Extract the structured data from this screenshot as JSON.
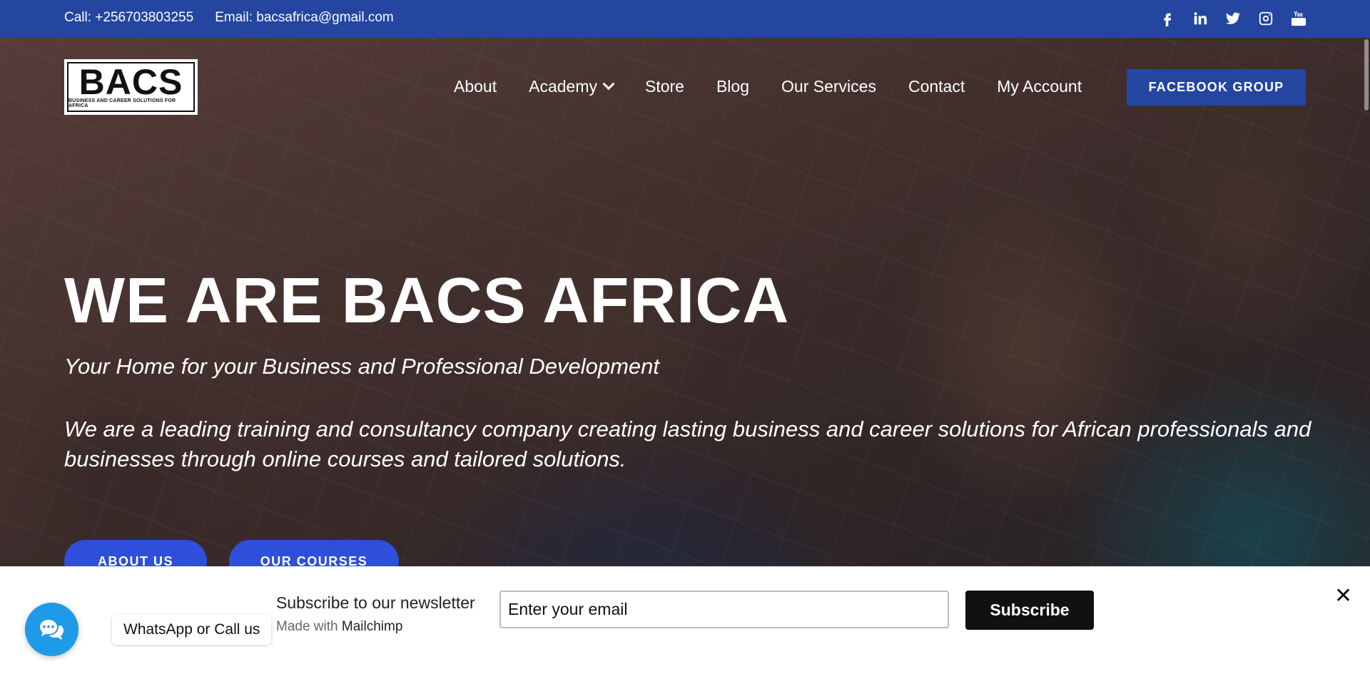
{
  "topbar": {
    "call": "Call: +256703803255",
    "email": "Email: bacsafrica@gmail.com",
    "social_icons": [
      "facebook-icon",
      "linkedin-icon",
      "twitter-icon",
      "instagram-icon",
      "youtube-icon"
    ]
  },
  "logo": {
    "mark": "BACS",
    "tagline": "BUSINESS AND CAREER SOLUTIONS FOR AFRICA"
  },
  "nav": {
    "items": [
      "About",
      "Academy",
      "Store",
      "Blog",
      "Our Services",
      "Contact",
      "My Account"
    ],
    "cta": "FACEBOOK GROUP"
  },
  "hero": {
    "title": "WE ARE BACS AFRICA",
    "subtitle": "Your Home for your Business and Professional Development",
    "description": "We are a leading training and consultancy company creating lasting business and career solutions for African professionals and businesses through online courses and tailored solutions.",
    "buttons": [
      "ABOUT US",
      "OUR COURSES"
    ]
  },
  "newsletter": {
    "title": "Subscribe to our newsletter",
    "made_with_prefix": "Made with",
    "made_with_brand": "Mailchimp",
    "input_value": "Enter your email",
    "button": "Subscribe",
    "close": "✕"
  },
  "whatsapp": {
    "label": "WhatsApp or Call us"
  },
  "colors": {
    "brand_blue": "#2446a0",
    "cta_blue": "#2e4fd9",
    "whatsapp_blue": "#1e9ae8"
  }
}
